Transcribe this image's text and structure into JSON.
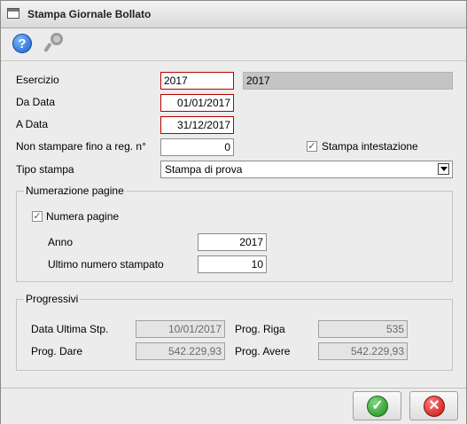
{
  "window": {
    "title": "Stampa Giornale Bollato"
  },
  "toolbar": {
    "help_icon": "help-icon",
    "search_icon": "search-icon"
  },
  "form": {
    "esercizio_label": "Esercizio",
    "esercizio_value": "2017",
    "esercizio_desc": "2017",
    "da_data_label": "Da Data",
    "da_data_value": "01/01/2017",
    "a_data_label": "A Data",
    "a_data_value": "31/12/2017",
    "non_stampare_label": "Non stampare fino a reg. n°",
    "non_stampare_value": "0",
    "stampa_intestazione_label": "Stampa intestazione",
    "stampa_intestazione_checked": true,
    "tipo_stampa_label": "Tipo stampa",
    "tipo_stampa_value": "Stampa di prova"
  },
  "numerazione": {
    "title": "Numerazione pagine",
    "numera_label": "Numera pagine",
    "numera_checked": true,
    "anno_label": "Anno",
    "anno_value": "2017",
    "ultimo_label": "Ultimo numero stampato",
    "ultimo_value": "10"
  },
  "progressivi": {
    "title": "Progressivi",
    "data_ultima_label": "Data Ultima Stp.",
    "data_ultima_value": "10/01/2017",
    "prog_riga_label": "Prog. Riga",
    "prog_riga_value": "535",
    "prog_dare_label": "Prog. Dare",
    "prog_dare_value": "542.229,93",
    "prog_avere_label": "Prog. Avere",
    "prog_avere_value": "542.229,93"
  },
  "footer": {
    "ok_icon": "checkmark-icon",
    "cancel_icon": "close-icon"
  }
}
